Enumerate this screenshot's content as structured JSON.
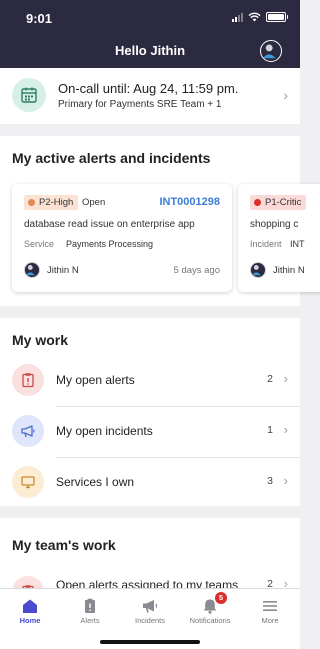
{
  "status_bar": {
    "time": "9:01"
  },
  "header": {
    "title": "Hello Jithin"
  },
  "oncall": {
    "title": "On-call until: Aug 24, 11:59 pm.",
    "subtitle": "Primary for Payments SRE Team + 1"
  },
  "active": {
    "title": "My active alerts and incidents",
    "cards": [
      {
        "priority": "P2-High",
        "priority_color": "#e08a54",
        "priority_bg": "#fbe2d3",
        "state": "Open",
        "number": "INT0001298",
        "description": "database read issue on enterprise app",
        "service_label": "Service",
        "service_value": "Payments Processing",
        "user": "Jithin N",
        "ago": "5 days ago"
      },
      {
        "priority": "P1-Critic",
        "priority_color": "#d9302c",
        "priority_bg": "#fad9d7",
        "state": "",
        "number": "",
        "description": "shopping c",
        "service_label": "Incident",
        "service_value": "INT",
        "user": "Jithin N",
        "ago": ""
      }
    ]
  },
  "my_work": {
    "title": "My work",
    "items": [
      {
        "label": "My open alerts",
        "count": "2",
        "icon": "alert-clipboard-icon",
        "icon_bg": "#fbe0e0"
      },
      {
        "label": "My open incidents",
        "count": "1",
        "icon": "megaphone-icon",
        "icon_bg": "#dfe6fb"
      },
      {
        "label": "Services I own",
        "count": "3",
        "icon": "monitor-icon",
        "icon_bg": "#fbecd3"
      }
    ]
  },
  "team_work": {
    "title": "My team's work",
    "items": [
      {
        "label": "Open alerts assigned to my teams",
        "count": "2",
        "icon": "alert-clipboard-icon",
        "icon_bg": "#fbe0e0"
      }
    ]
  },
  "tabs": [
    {
      "label": "Home",
      "icon": "home-icon",
      "active": true
    },
    {
      "label": "Alerts",
      "icon": "alert-clipboard-icon"
    },
    {
      "label": "Incidents",
      "icon": "megaphone-icon"
    },
    {
      "label": "Notifications",
      "icon": "bell-icon",
      "badge": "5"
    },
    {
      "label": "More",
      "icon": "menu-icon"
    }
  ],
  "colors": {
    "header_bg": "#2b2a40",
    "accent": "#4a4ad0",
    "link": "#3d7dd6",
    "badge": "#d9302c"
  }
}
